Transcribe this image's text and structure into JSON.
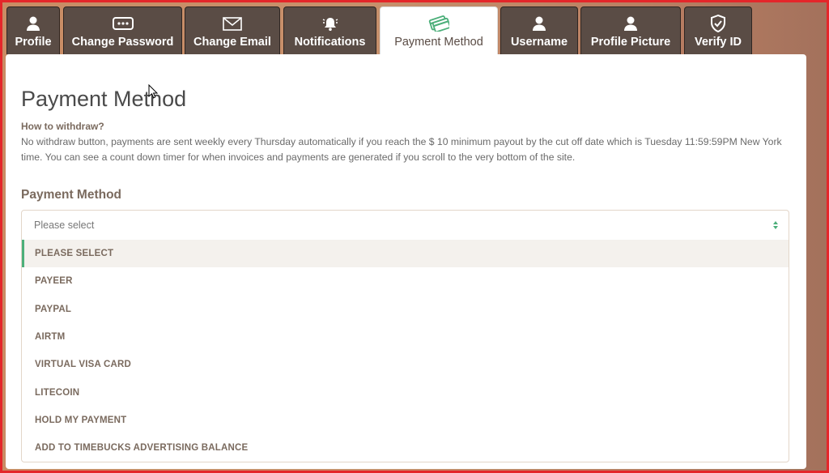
{
  "tabs": [
    {
      "label": "Profile",
      "icon": "user-icon"
    },
    {
      "label": "Change Password",
      "icon": "password-icon"
    },
    {
      "label": "Change Email",
      "icon": "envelope-icon"
    },
    {
      "label": "Notifications",
      "icon": "bell-icon"
    },
    {
      "label": "Payment Method",
      "icon": "credit-card-icon",
      "active": true
    },
    {
      "label": "Username",
      "icon": "user-icon"
    },
    {
      "label": "Profile Picture",
      "icon": "user-icon"
    },
    {
      "label": "Verify ID",
      "icon": "shield-check-icon"
    }
  ],
  "page": {
    "title": "Payment Method",
    "how_heading": "How to withdraw?",
    "how_text": "No withdraw button, payments are sent weekly every Thursday automatically if you reach the $ 10 minimum payout by the cut off date which is Tuesday 11:59:59PM New York time. You can see a count down timer for when invoices and payments are generated if you scroll to the very bottom of the site."
  },
  "payment_select": {
    "label": "Payment Method",
    "placeholder": "Please select",
    "options": [
      "PLEASE SELECT",
      "PAYEER",
      "PAYPAL",
      "AIRTM",
      "VIRTUAL VISA CARD",
      "LITECOIN",
      "HOLD MY PAYMENT",
      "ADD TO TIMEBUCKS ADVERTISING BALANCE"
    ],
    "highlighted_index": 0
  },
  "colors": {
    "tab_bg": "#5a4c45",
    "accent_green": "#4caf7a",
    "frame_red": "#e4262a"
  }
}
